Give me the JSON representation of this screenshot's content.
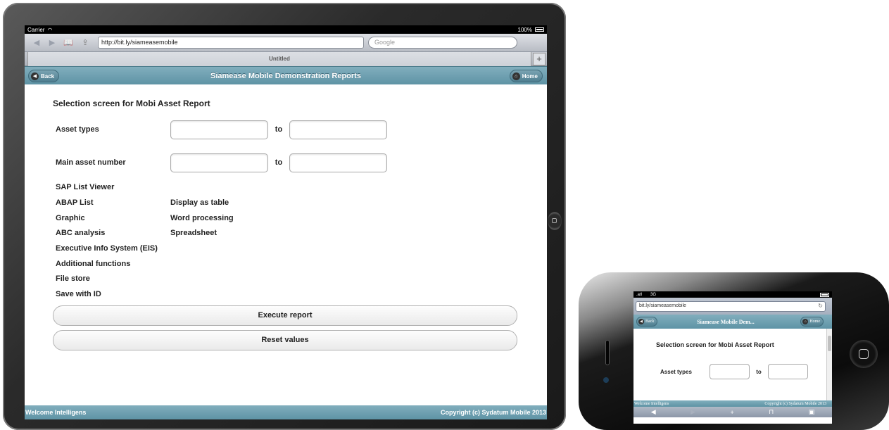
{
  "ipad": {
    "status": {
      "carrier": "Carrier",
      "battery": "100%"
    },
    "browser": {
      "url": "http://bit.ly/siameasemobile",
      "search_placeholder": "Google",
      "tab_title": "Untitled",
      "new_tab": "+"
    },
    "header": {
      "title": "Siamease Mobile Demonstration Reports",
      "back": "Back",
      "home": "Home"
    },
    "form": {
      "title": "Selection screen for Mobi Asset Report",
      "rows": [
        {
          "label": "Asset types",
          "to": "to"
        },
        {
          "label": "Main asset number",
          "to": "to"
        }
      ],
      "options_left": [
        "SAP List Viewer",
        "ABAP List",
        "Graphic",
        "ABC analysis",
        "Executive Info System (EIS)",
        "Additional functions",
        "File store",
        "Save with ID"
      ],
      "options_right": [
        "Display as table",
        "Word processing",
        "Spreadsheet"
      ],
      "execute": "Execute report",
      "reset": "Reset values"
    },
    "footer": {
      "left": "Welcome Intelligens",
      "right": "Copyright (c) Sydatum Mobile 2013"
    }
  },
  "iphone": {
    "status": {
      "signal": ".atl",
      "network": "3G"
    },
    "browser": {
      "url": "bit.ly/siameasemobile"
    },
    "header": {
      "title": "Siamease Mobile Dem...",
      "back": "Back",
      "home": "Home"
    },
    "form": {
      "title": "Selection screen for Mobi Asset Report",
      "label": "Asset types",
      "to": "to"
    },
    "footer": {
      "left": "Welcome Intelligens",
      "right": "Copyright (c) Sydatum Mobile 2013"
    }
  },
  "colors": {
    "header": "#6fa0b1",
    "bezel": "#1a1a1a"
  }
}
